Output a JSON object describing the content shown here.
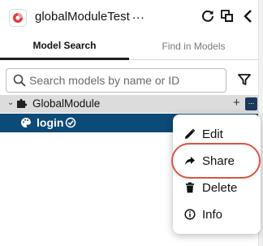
{
  "header": {
    "title": "globalModuleTest",
    "more_label": "...",
    "icons": [
      "app-logo-icon",
      "refresh-icon",
      "copy-icon",
      "chevron-left-icon"
    ]
  },
  "tabs": [
    {
      "label": "Model Search",
      "active": true
    },
    {
      "label": "Find in Models",
      "active": false
    }
  ],
  "search": {
    "placeholder": "Search models by name or ID",
    "value": ""
  },
  "tree": {
    "module": {
      "label": "GlobalModule",
      "expanded": true,
      "plus_label": "+",
      "more_label": "..."
    },
    "children": [
      {
        "label": "login",
        "selected": true,
        "icon": "palette-icon",
        "status_icon": "check-circle-icon"
      }
    ]
  },
  "context_menu": {
    "items": [
      {
        "label": "Edit",
        "icon": "pencil-icon"
      },
      {
        "label": "Share",
        "icon": "share-arrow-icon",
        "highlighted": true
      },
      {
        "label": "Delete",
        "icon": "trash-icon"
      },
      {
        "label": "Info",
        "icon": "info-icon"
      }
    ]
  },
  "colors": {
    "selected_row": "#0c4a78",
    "module_row": "#dcdcdc",
    "highlight_ring": "#d9553f",
    "more_button": "#1a3a5c"
  }
}
